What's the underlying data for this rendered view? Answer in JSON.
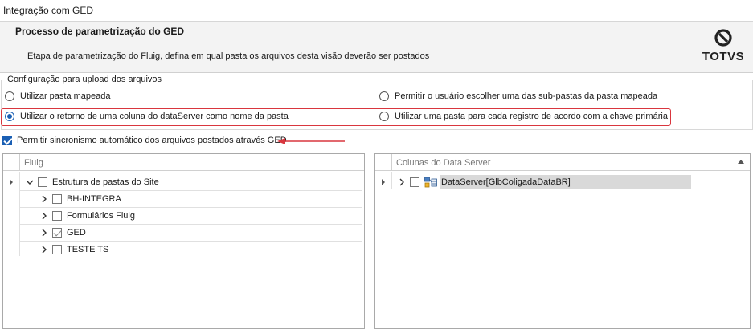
{
  "window": {
    "title": "Integração com GED"
  },
  "header": {
    "title": "Processo de parametrização do GED",
    "description": "Etapa de parametrização do Fluig, defina em qual pasta os arquivos desta visão deverão ser postados",
    "logo_text": "TOTVS"
  },
  "upload_config": {
    "group_label": "Configuração para upload dos arquivos",
    "options": [
      {
        "label": "Utilizar pasta mapeada",
        "checked": false
      },
      {
        "label": "Permitir o usuário escolher uma das sub-pastas da pasta mapeada",
        "checked": false
      },
      {
        "label": "Utilizar o retorno de uma coluna do dataServer como nome da pasta",
        "checked": true
      },
      {
        "label": "Utilizar uma pasta para cada registro de acordo com a chave primária",
        "checked": false
      }
    ]
  },
  "sync": {
    "label": "Permitir sincronismo automático dos arquivos postados através GED",
    "checked": true
  },
  "fluig_panel": {
    "header": "Fluig",
    "root": {
      "label": "Estrutura de pastas do Site",
      "expanded": true,
      "checked": false
    },
    "children": [
      {
        "label": "BH-INTEGRA",
        "checked": false
      },
      {
        "label": "Formulários Fluig",
        "checked": false
      },
      {
        "label": "GED",
        "checked": true
      },
      {
        "label": "TESTE TS",
        "checked": false
      }
    ]
  },
  "dataserver_panel": {
    "header": "Colunas do Data Server",
    "item": {
      "label": "DataServer[GlbColigadaDataBR]",
      "checked": false,
      "icon": "dataserver-icon"
    }
  },
  "colors": {
    "accent": "#1a5fb4",
    "highlight": "#d9363e",
    "selected_row": "#d9d9d9"
  }
}
